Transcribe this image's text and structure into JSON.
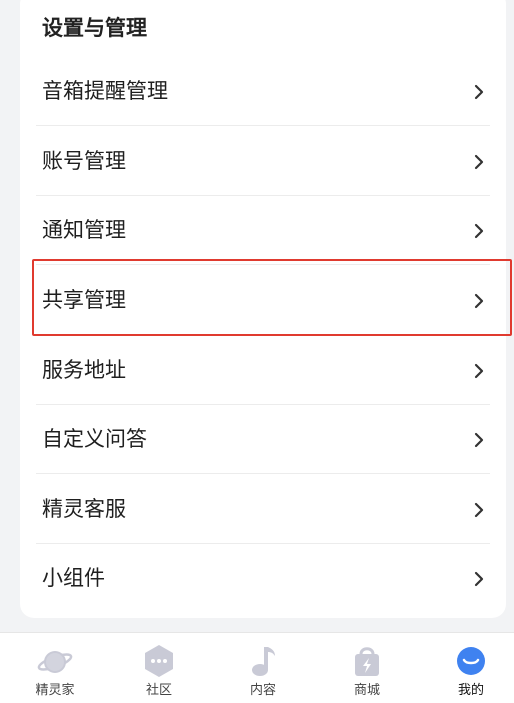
{
  "section": {
    "title": "设置与管理"
  },
  "menu": [
    {
      "label": "音箱提醒管理"
    },
    {
      "label": "账号管理"
    },
    {
      "label": "通知管理"
    },
    {
      "label": "共享管理",
      "highlighted": true
    },
    {
      "label": "服务地址"
    },
    {
      "label": "自定义问答"
    },
    {
      "label": "精灵客服"
    },
    {
      "label": "小组件"
    }
  ],
  "highlight_color": "#e03a2f",
  "tabs": [
    {
      "label": "精灵家",
      "icon": "planet-icon"
    },
    {
      "label": "社区",
      "icon": "chat-hexagon-icon"
    },
    {
      "label": "内容",
      "icon": "music-note-icon"
    },
    {
      "label": "商城",
      "icon": "shopping-bag-icon"
    },
    {
      "label": "我的",
      "icon": "profile-icon",
      "active": true
    }
  ],
  "colors": {
    "background": "#f2f3f5",
    "card": "#ffffff",
    "tab_icon": "#c9cad6",
    "active_tab_icon": "#3f82f0"
  }
}
